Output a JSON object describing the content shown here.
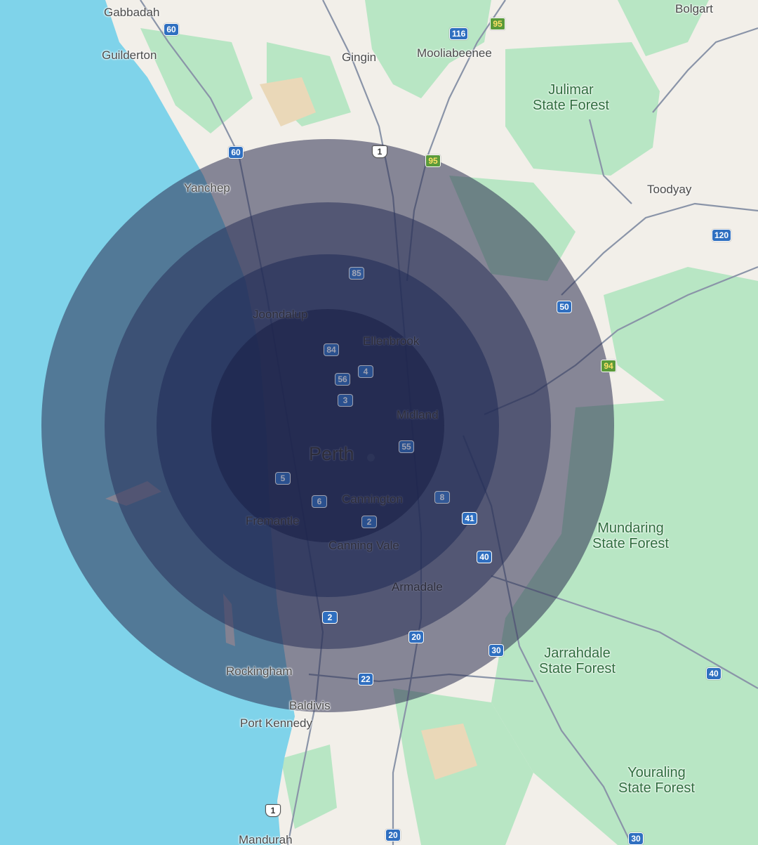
{
  "places": [
    {
      "name": "Gabbadah",
      "type": "town"
    },
    {
      "name": "Guilderton",
      "type": "town"
    },
    {
      "name": "Gingin",
      "type": "town"
    },
    {
      "name": "Mooliabeenee",
      "type": "town"
    },
    {
      "name": "Bolgart",
      "type": "town"
    },
    {
      "name": "Yanchep",
      "type": "town"
    },
    {
      "name": "Toodyay",
      "type": "town"
    },
    {
      "name": "Joondalup",
      "type": "town"
    },
    {
      "name": "Ellenbrook",
      "type": "town"
    },
    {
      "name": "Midland",
      "type": "town"
    },
    {
      "name": "Perth",
      "type": "city"
    },
    {
      "name": "Cannington",
      "type": "town"
    },
    {
      "name": "Fremantle",
      "type": "town"
    },
    {
      "name": "Canning Vale",
      "type": "town"
    },
    {
      "name": "Armadale",
      "type": "town"
    },
    {
      "name": "Rockingham",
      "type": "town"
    },
    {
      "name": "Baldivis",
      "type": "town"
    },
    {
      "name": "Port Kennedy",
      "type": "town"
    },
    {
      "name": "Mandurah",
      "type": "town"
    }
  ],
  "forests": [
    {
      "line1": "Julimar",
      "line2": "State Forest"
    },
    {
      "line1": "Mundaring",
      "line2": "State Forest"
    },
    {
      "line1": "Jarrahdale",
      "line2": "State Forest"
    },
    {
      "line1": "Youraling",
      "line2": "State Forest"
    }
  ],
  "routes": [
    {
      "num": "60",
      "kind": "metro"
    },
    {
      "num": "116",
      "kind": "metro"
    },
    {
      "num": "95",
      "kind": "state"
    },
    {
      "num": "60",
      "kind": "metro"
    },
    {
      "num": "1",
      "kind": "national"
    },
    {
      "num": "95",
      "kind": "state"
    },
    {
      "num": "120",
      "kind": "metro"
    },
    {
      "num": "85",
      "kind": "metro"
    },
    {
      "num": "50",
      "kind": "metro"
    },
    {
      "num": "84",
      "kind": "metro"
    },
    {
      "num": "4",
      "kind": "metro"
    },
    {
      "num": "56",
      "kind": "metro"
    },
    {
      "num": "3",
      "kind": "metro"
    },
    {
      "num": "94",
      "kind": "state"
    },
    {
      "num": "55",
      "kind": "metro"
    },
    {
      "num": "5",
      "kind": "metro"
    },
    {
      "num": "6",
      "kind": "metro"
    },
    {
      "num": "8",
      "kind": "metro"
    },
    {
      "num": "2",
      "kind": "metro"
    },
    {
      "num": "41",
      "kind": "metro"
    },
    {
      "num": "40",
      "kind": "metro"
    },
    {
      "num": "2",
      "kind": "metro"
    },
    {
      "num": "20",
      "kind": "metro"
    },
    {
      "num": "30",
      "kind": "metro"
    },
    {
      "num": "22",
      "kind": "metro"
    },
    {
      "num": "40",
      "kind": "metro"
    },
    {
      "num": "1",
      "kind": "national"
    },
    {
      "num": "20",
      "kind": "metro"
    },
    {
      "num": "30",
      "kind": "metro"
    }
  ],
  "rings": [
    {
      "radius_km": "4",
      "fill": "#1b2147"
    },
    {
      "radius_km": "3",
      "fill": "#1f2a55"
    },
    {
      "radius_km": "2",
      "fill": "#2a3159"
    },
    {
      "radius_km": "1",
      "fill": "#2d3052"
    }
  ],
  "colors": {
    "ocean": "#7fd3ea",
    "land": "#f2efe9",
    "forest": "#b8e6c4",
    "urban": "#ebe6df",
    "road": "#8a94a8"
  }
}
